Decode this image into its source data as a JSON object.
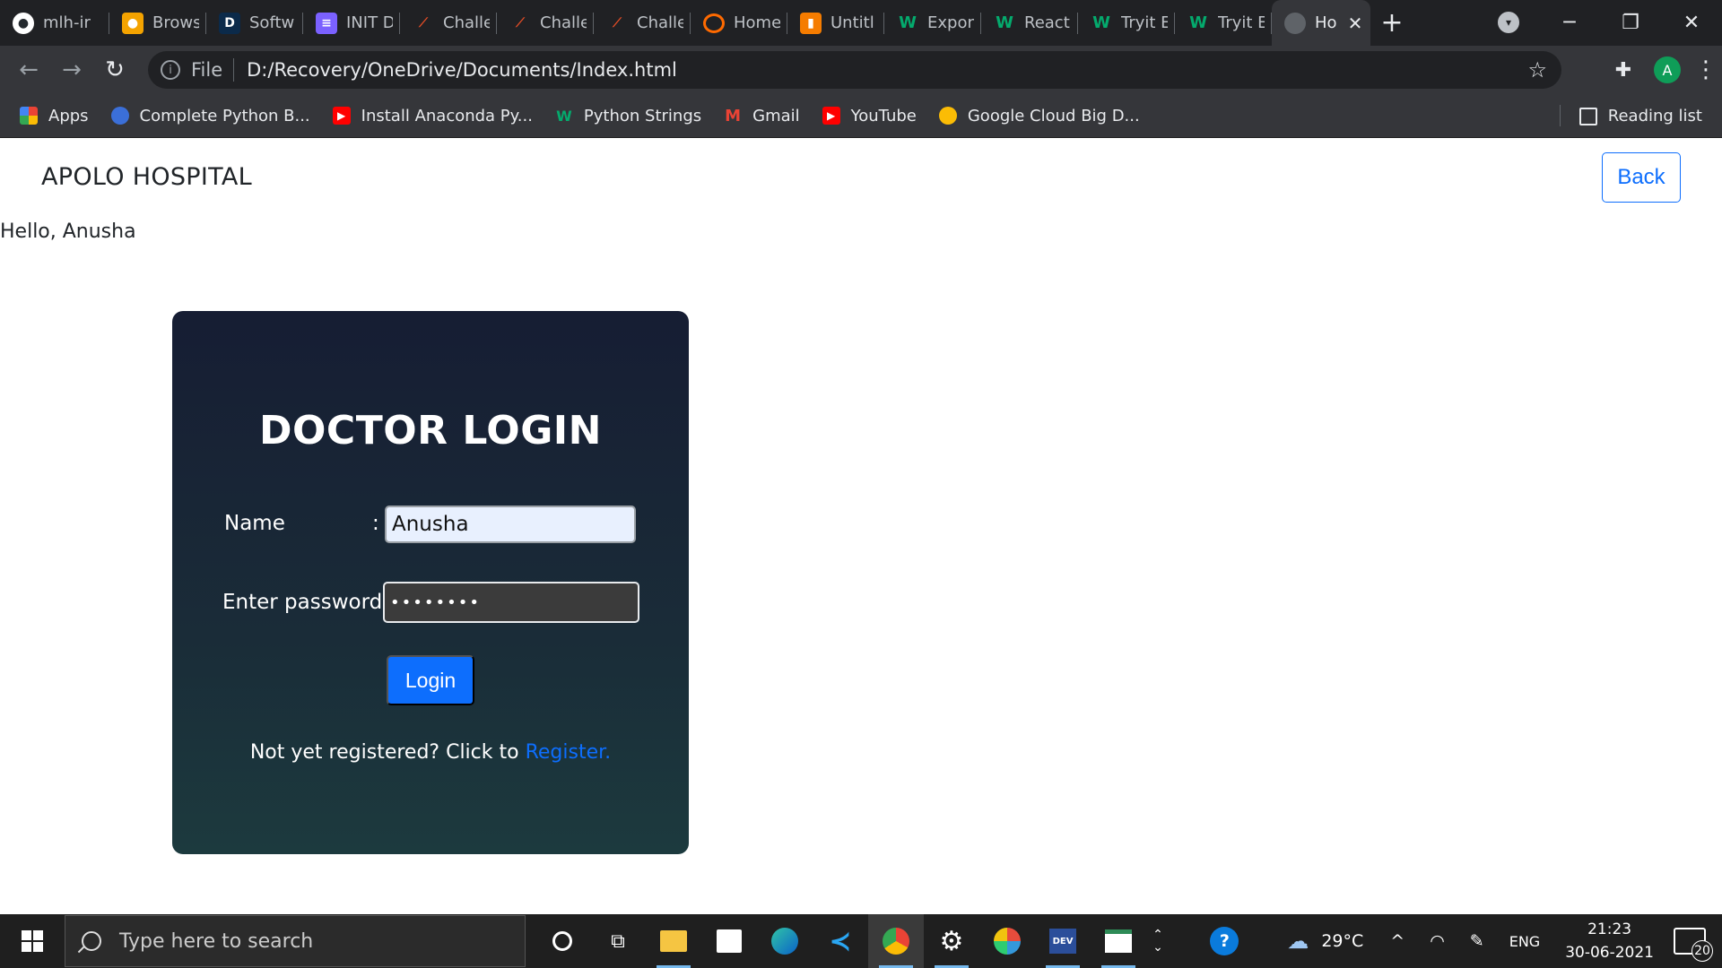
{
  "browser": {
    "tabs": [
      {
        "title": "mlh-ir",
        "icon": "github-icon",
        "color": "#24292e"
      },
      {
        "title": "Brows",
        "icon": "browserstack-icon",
        "color": "#f4a300"
      },
      {
        "title": "Softw",
        "icon": "d-icon",
        "color": "#0b3d91"
      },
      {
        "title": "INIT D",
        "icon": "list-icon",
        "color": "#7b61ff"
      },
      {
        "title": "Challe",
        "icon": "code-icon",
        "color": "#e44d26"
      },
      {
        "title": "Challe",
        "icon": "code-icon",
        "color": "#e44d26"
      },
      {
        "title": "Challe",
        "icon": "code-icon",
        "color": "#e44d26"
      },
      {
        "title": "Home",
        "icon": "circle-icon",
        "color": "#ff6a00"
      },
      {
        "title": "Untitl",
        "icon": "notebook-icon",
        "color": "#f57c00"
      },
      {
        "title": "Expon",
        "icon": "w3schools-icon",
        "color": "#04aa6d"
      },
      {
        "title": "React",
        "icon": "w3schools-icon",
        "color": "#04aa6d"
      },
      {
        "title": "Tryit E",
        "icon": "w3schools-icon",
        "color": "#04aa6d"
      },
      {
        "title": "Tryit E",
        "icon": "w3schools-icon",
        "color": "#04aa6d"
      },
      {
        "title": "Ho",
        "icon": "globe-icon",
        "color": "#5f6368",
        "active": true
      }
    ],
    "address": {
      "scheme": "File",
      "url": "D:/Recovery/OneDrive/Documents/Index.html"
    },
    "profile_initial": "A",
    "bookmarks": [
      {
        "label": "Apps",
        "icon": "apps-grid-icon"
      },
      {
        "label": "Complete Python B...",
        "icon": "python-icon"
      },
      {
        "label": "Install Anaconda Py...",
        "icon": "youtube-icon"
      },
      {
        "label": "Python Strings",
        "icon": "w3schools-icon"
      },
      {
        "label": "Gmail",
        "icon": "gmail-icon"
      },
      {
        "label": "YouTube",
        "icon": "youtube-icon"
      },
      {
        "label": "Google Cloud Big D...",
        "icon": "coursera-icon"
      }
    ],
    "reading_list": "Reading list"
  },
  "page": {
    "brand": "APOLO HOSPITAL",
    "back_label": "Back",
    "greeting": "Hello, Anusha",
    "login": {
      "title": "DOCTOR LOGIN",
      "name_label": "Name",
      "name_colon": ":",
      "name_value": "Anusha",
      "password_label": "Enter password :",
      "password_mask": "••••••••",
      "button": "Login",
      "register_prompt": "Not yet registered? Click to",
      "register_link": "Register."
    }
  },
  "taskbar": {
    "search_placeholder": "Type here to search",
    "weather": "29°C",
    "language": "ENG",
    "time": "21:23",
    "date": "30-06-2021",
    "notifications": "20"
  },
  "colors": {
    "primary": "#0d6efd",
    "card_top": "#161d33",
    "card_bottom": "#1c3a3e"
  }
}
